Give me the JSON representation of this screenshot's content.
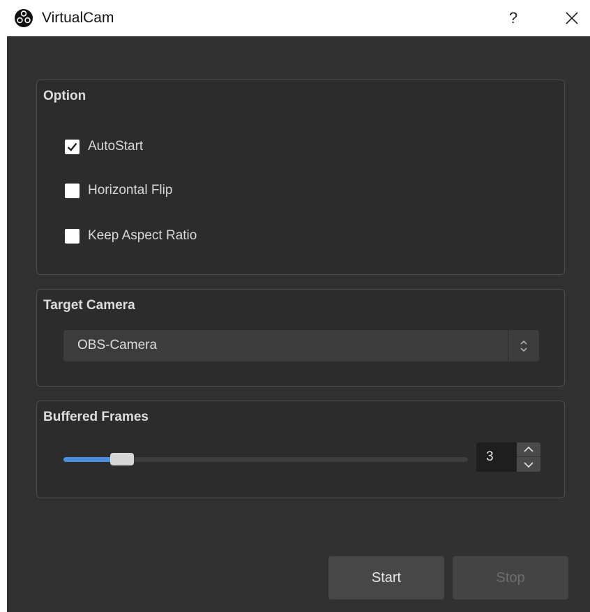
{
  "window": {
    "title": "VirtualCam",
    "help_label": "?"
  },
  "option_group": {
    "title": "Option",
    "checkboxes": [
      {
        "label": "AutoStart",
        "checked": true
      },
      {
        "label": "Horizontal Flip",
        "checked": false
      },
      {
        "label": "Keep Aspect Ratio",
        "checked": false
      }
    ]
  },
  "target_camera_group": {
    "title": "Target Camera",
    "selected": "OBS-Camera"
  },
  "buffered_frames_group": {
    "title": "Buffered Frames",
    "value": "3",
    "slider_fraction": 0.13
  },
  "buttons": {
    "start": "Start",
    "stop": "Stop"
  },
  "colors": {
    "background": "#313131",
    "panel": "#2c2c2c",
    "accent": "#4a8fe0",
    "text": "#dddddd",
    "disabled_text": "#6e6e6e"
  },
  "icons": {
    "app": "obs-logo-icon",
    "close": "close-icon",
    "dropdown": "up-down-chevron-icon",
    "check": "checkmark-icon"
  }
}
